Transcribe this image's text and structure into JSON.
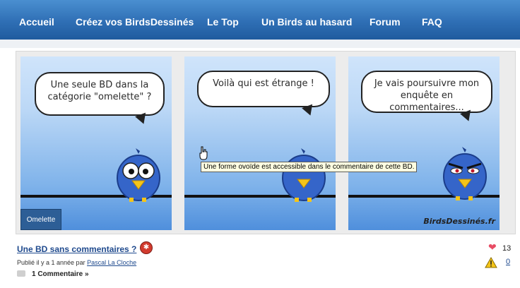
{
  "nav": {
    "items": [
      "Accueil",
      "Créez vos BirdsDessinés",
      "Le Top",
      "Un Birds au hasard",
      "Forum",
      "FAQ"
    ]
  },
  "comic": {
    "panels": [
      {
        "bubble": "Une seule BD dans la catégorie \"omelette\" ?"
      },
      {
        "bubble": "Voilà qui est étrange !"
      },
      {
        "bubble": "Je vais poursuivre mon enquête en commentaires..."
      }
    ],
    "category_tag": "Omelette",
    "logo": "BirdsDessinés.fr",
    "tooltip": "Une forme ovoïde est accessible dans le commentaire de cette BD."
  },
  "post": {
    "title": "Une BD sans commentaires ?",
    "meta_prefix": "Publié il y a 1 année par",
    "author": "Pascal La Cloche",
    "comments_label": "1 Commentaire »",
    "likes": "13",
    "reports": "0"
  },
  "colors": {
    "nav": "#2f6fb5",
    "accent": "#1f4a8e",
    "bird": "#3565c9"
  }
}
